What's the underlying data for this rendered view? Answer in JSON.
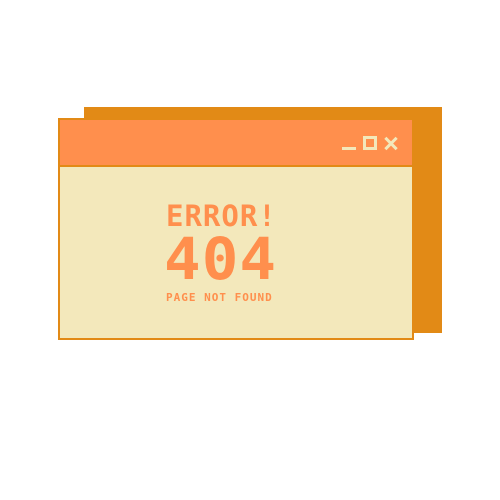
{
  "window": {
    "title_bar_controls": {
      "minimize_label": "",
      "maximize_label": "",
      "close_label": ""
    },
    "error_title": "ERROR!",
    "error_code": "404",
    "error_subtitle": "PAGE NOT FOUND"
  },
  "icons": {
    "minimize": "minimize-icon",
    "maximize": "maximize-icon",
    "close": "close-icon"
  },
  "colors": {
    "accent": "#ff8f4d",
    "shadow": "#e28a16",
    "window_background": "#f3e8bb"
  }
}
